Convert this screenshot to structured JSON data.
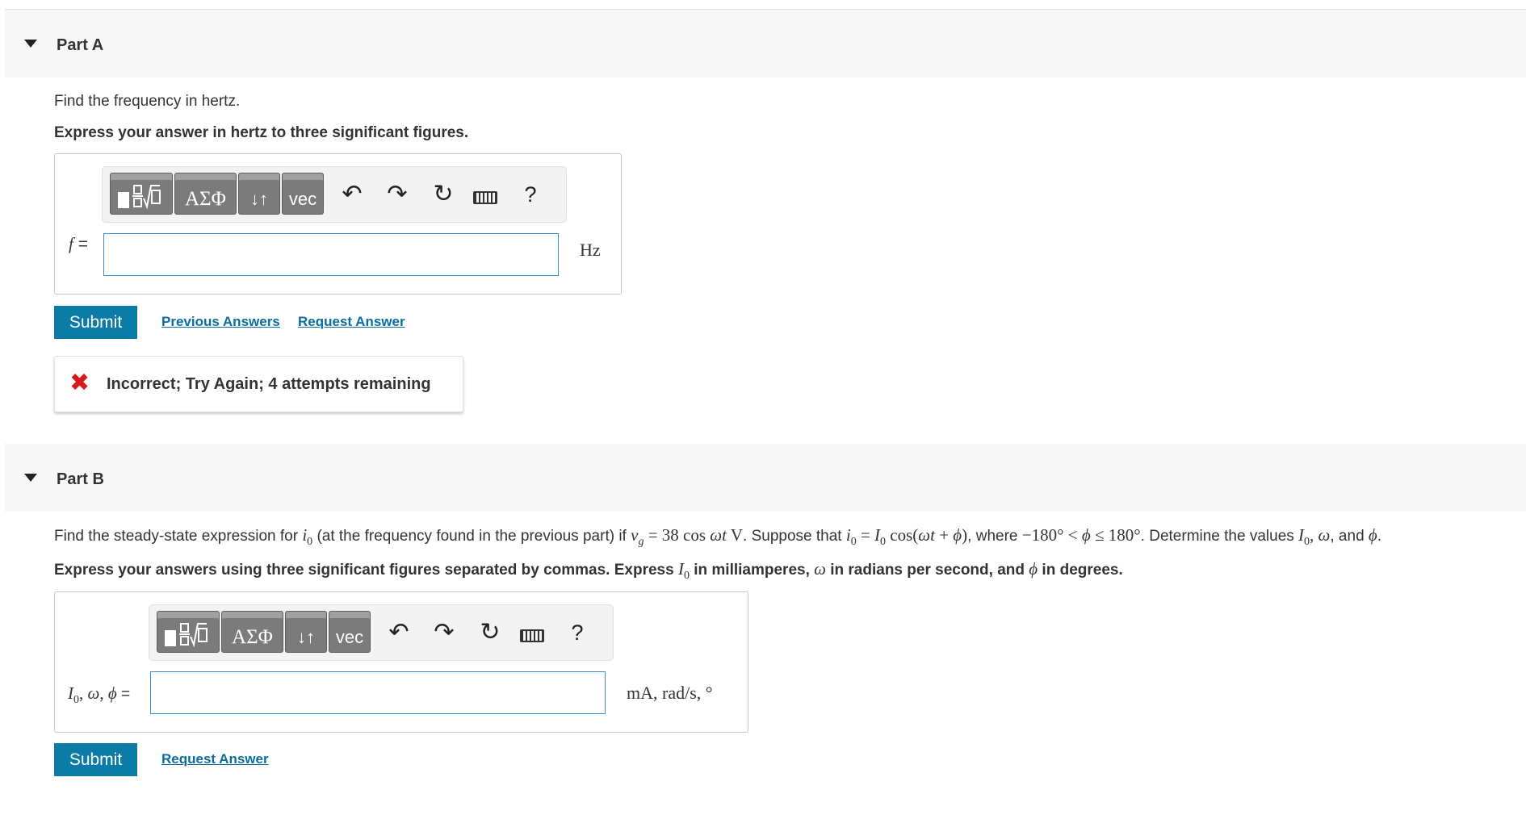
{
  "partA": {
    "title": "Part A",
    "prompt": "Find the frequency in hertz.",
    "instruction": "Express your answer in hertz to three significant figures.",
    "variable": "f",
    "equals": "=",
    "answer_value": "",
    "unit": "Hz",
    "submit_label": "Submit",
    "previous_answers_label": "Previous Answers",
    "request_answer_label": "Request Answer",
    "feedback_icon": "close-icon",
    "feedback_symbol": "✖",
    "feedback_text": "Incorrect; Try Again; 4 attempts remaining",
    "feedback_color": "#d7191c"
  },
  "partB": {
    "title": "Part B",
    "prompt": {
      "t1": "Find the steady-state expression for ",
      "t2": " (at the frequency found in the previous part) if ",
      "vg_eq": " = 38 cos ",
      "vg_unit": " V",
      "t3": ". Suppose that ",
      "eq1": " = ",
      "cos": " cos(",
      "plus": " + ",
      "close": ")",
      "t4": ", where ",
      "range1": "−180° < ",
      "range2": " ≤ 180°",
      "t5": ". Determine the values ",
      "comma": ", ",
      "t6": ", and ",
      "t7": "."
    },
    "instruction": {
      "t1": "Express your answers using three significant figures separated by commas. Express ",
      "t2": " in milliamperes, ",
      "t3": " in radians per second, and ",
      "t4": " in degrees."
    },
    "var_label": {
      "comma": ", ",
      "equals": " ="
    },
    "answer_value": "",
    "unit": "mA, rad/s, °",
    "submit_label": "Submit",
    "request_answer_label": "Request Answer"
  },
  "symbols": {
    "i": "i",
    "v": "v",
    "zero": "0",
    "g": "g",
    "I": "I",
    "omega": "ω",
    "t": "t",
    "phi": "ϕ"
  },
  "toolbar": {
    "templates_icon": "fraction-sqrt-template-icon",
    "greek_label": "ΑΣΦ",
    "greek_icon": "greek-letters-icon",
    "sort_label": "↓↑",
    "sort_icon": "subscript-superscript-icon",
    "vec_label": "vec",
    "vec_icon": "vector-icon",
    "undo": "↶",
    "redo": "↷",
    "reset": "↻",
    "keyboard_icon": "keyboard-icon",
    "help": "?"
  },
  "colors": {
    "submit_bg": "#0b7ca5",
    "link": "#0b6d9c",
    "input_border": "#3b8ec7",
    "toolbar_button": "#7b7b7b"
  }
}
